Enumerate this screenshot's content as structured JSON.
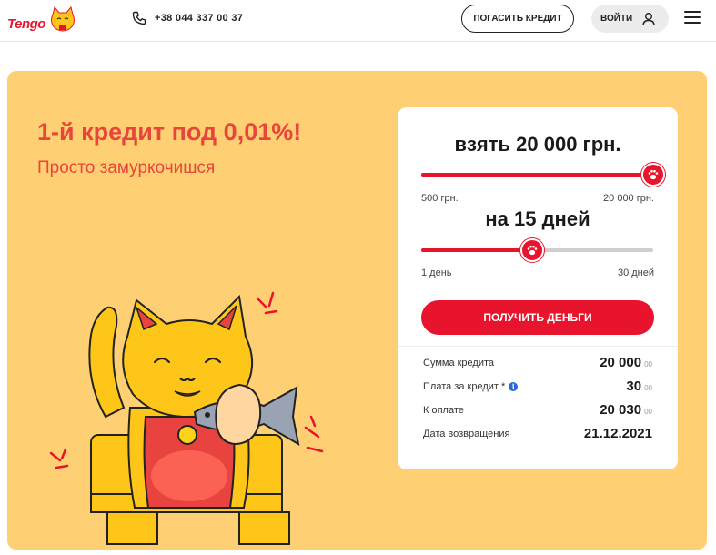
{
  "header": {
    "logo_text": "Tengo",
    "phone": "+38 044 337 00 37",
    "repay_button": "ПОГАСИТЬ КРЕДИТ",
    "login_button": "ВОЙТИ",
    "icons": [
      "phone-icon",
      "user-icon",
      "hamburger-menu-icon",
      "cat-logo-icon"
    ]
  },
  "hero": {
    "title": "1-й кредит под 0,01%!",
    "subtitle": "Просто замуркочишся"
  },
  "calculator": {
    "amount_title": "взять 20 000 грн.",
    "amount_min": "500 грн.",
    "amount_max": "20 000 грн.",
    "amount_fraction": 1.0,
    "term_title": "на 15 дней",
    "term_min": "1 день",
    "term_max": "30 дней",
    "term_fraction": 0.48,
    "submit_button": "ПОЛУЧИТЬ ДЕНЬГИ",
    "summary": [
      {
        "label": "Сумма кредита",
        "value": "20 000",
        "cents": "00",
        "info": false
      },
      {
        "label": "Плата за кредит *",
        "value": "30",
        "cents": "00",
        "info": true
      },
      {
        "label": "К оплате",
        "value": "20 030",
        "cents": "00",
        "info": false
      },
      {
        "label": "Дата возвращения",
        "value": "21.12.2021",
        "cents": "",
        "info": false
      }
    ]
  },
  "colors": {
    "brand_red": "#e8132c",
    "hero_text": "#e8453c",
    "banner_bg": "#ffd073",
    "info_blue": "#2a6ad8"
  }
}
